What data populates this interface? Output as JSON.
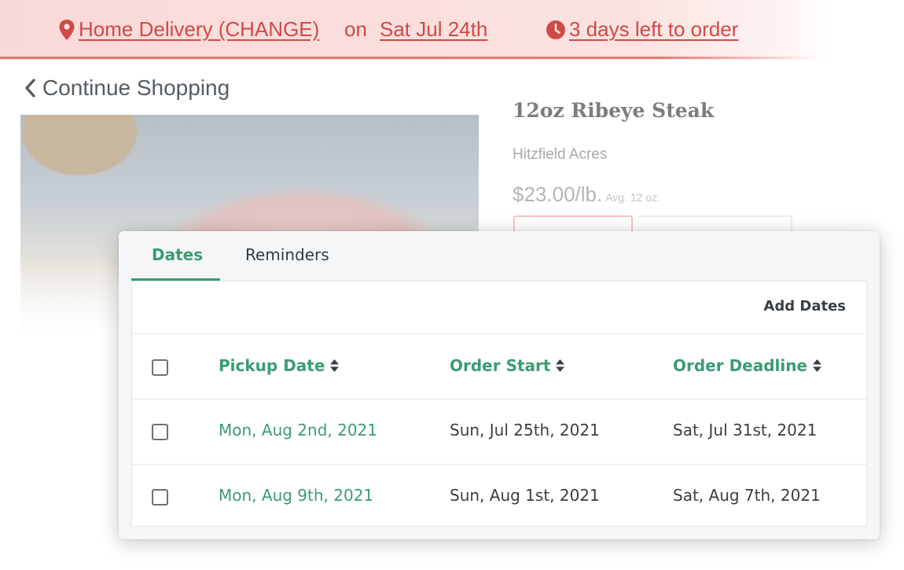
{
  "banner": {
    "delivery_label": " Home Delivery (CHANGE)",
    "on_label": "on",
    "date_label": "Sat Jul 24th",
    "days_left_label": " 3 days left to order",
    "accent_color": "#cf4a45"
  },
  "nav": {
    "continue_label": "Continue Shopping"
  },
  "product": {
    "title": "12oz Ribeye Steak",
    "vendor": "Hitzfield Acres",
    "price": "$23.00/lb.",
    "avg": "Avg. 12 oz."
  },
  "panel": {
    "tabs": [
      {
        "label": "Dates",
        "active": true
      },
      {
        "label": "Reminders",
        "active": false
      }
    ],
    "add_dates_label": "Add Dates",
    "columns": [
      "Pickup Date",
      "Order Start",
      "Order Deadline"
    ],
    "rows": [
      {
        "pickup": "Mon, Aug 2nd, 2021",
        "start": "Sun, Jul 25th, 2021",
        "deadline": "Sat, Jul 31st, 2021"
      },
      {
        "pickup": "Mon, Aug 9th, 2021",
        "start": "Sun, Aug 1st, 2021",
        "deadline": "Sat, Aug 7th, 2021"
      }
    ],
    "accent_color": "#3b9c72"
  }
}
